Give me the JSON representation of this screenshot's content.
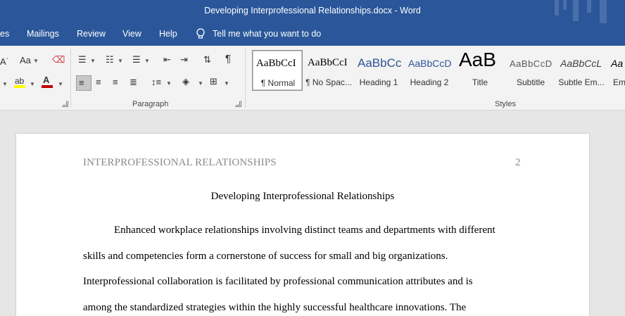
{
  "window": {
    "title": "Developing Interprofessional Relationships.docx  -  Word"
  },
  "tabs": [
    "es",
    "Mailings",
    "Review",
    "View",
    "Help"
  ],
  "tellme": {
    "text": "Tell me what you want to do"
  },
  "ribbon": {
    "paragraph_label": "Paragraph",
    "styles_label": "Styles",
    "font_size_glyph": "Aa",
    "styles": [
      {
        "preview": "AaBbCcI",
        "name": "¶ Normal"
      },
      {
        "preview": "AaBbCcI",
        "name": "¶ No Spac..."
      },
      {
        "preview": "AaBbCc",
        "name": "Heading 1"
      },
      {
        "preview": "AaBbCcD",
        "name": "Heading 2"
      },
      {
        "preview": "AaB",
        "name": "Title"
      },
      {
        "preview": "AaBbCcD",
        "name": "Subtitle"
      },
      {
        "preview": "AaBbCcL",
        "name": "Subtle Em..."
      },
      {
        "preview": "Aa",
        "name": "Em"
      }
    ]
  },
  "colors": {
    "accent": "#2b579a",
    "highlight": "#ffff00",
    "font_color": "#c00000"
  },
  "document": {
    "header_text": "INTERPROFESSIONAL RELATIONSHIPS",
    "page_number": "2",
    "title": "Developing Interprofessional Relationships",
    "lines": [
      "Enhanced workplace relationships involving distinct teams and departments with different",
      "skills and competencies form a cornerstone of success for small and big organizations.",
      "Interprofessional collaboration is facilitated by professional communication attributes and is",
      "among the standardized strategies within the highly successful healthcare innovations. The"
    ]
  }
}
